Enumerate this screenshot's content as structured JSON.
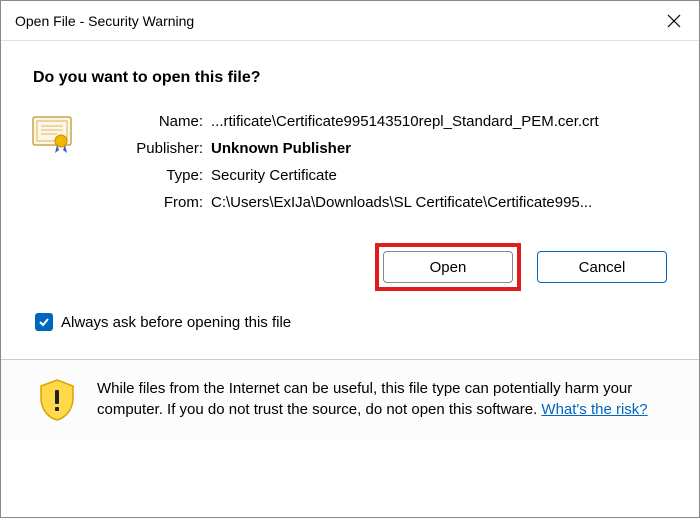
{
  "titlebar": {
    "title": "Open File - Security Warning"
  },
  "question": "Do you want to open this file?",
  "fields": {
    "name_label": "Name:",
    "name_value": "...rtificate\\Certificate995143510repl_Standard_PEM.cer.crt",
    "publisher_label": "Publisher:",
    "publisher_value": "Unknown Publisher",
    "type_label": "Type:",
    "type_value": "Security Certificate",
    "from_label": "From:",
    "from_value": "C:\\Users\\ExIJa\\Downloads\\SL Certificate\\Certificate995..."
  },
  "buttons": {
    "open": "Open",
    "cancel": "Cancel"
  },
  "checkbox": {
    "label": "Always ask before opening this file",
    "checked": true
  },
  "footer": {
    "text_before": "While files from the Internet can be useful, this file type can potentially harm your computer. If you do not trust the source, do not open this software. ",
    "link": "What's the risk?"
  }
}
